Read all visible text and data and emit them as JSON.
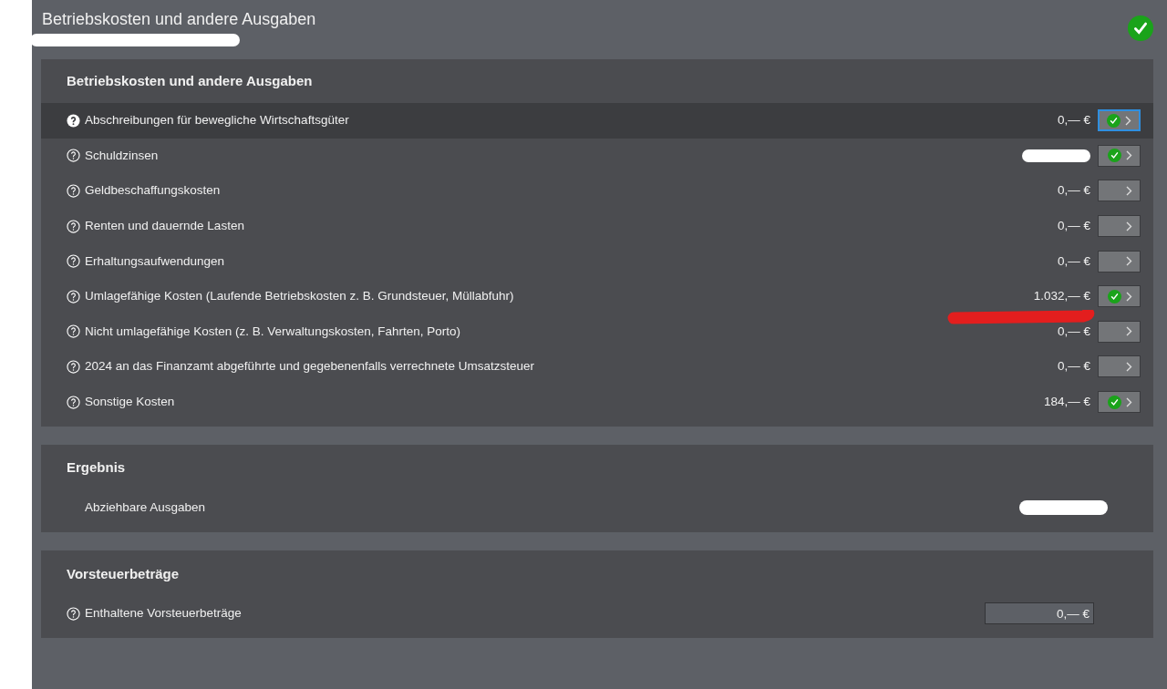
{
  "page": {
    "title": "Betriebskosten und andere Ausgaben",
    "subtitle_redacted": true,
    "complete": true
  },
  "costs": {
    "title": "Betriebskosten und andere Ausgaben",
    "rows": [
      {
        "label": "Abschreibungen für bewegliche Wirtschaftsgüter",
        "value": "0,— €",
        "done": true,
        "selected": true
      },
      {
        "label": "Schuldzinsen",
        "redacted": true,
        "done": true,
        "selected": false
      },
      {
        "label": "Geldbeschaffungskosten",
        "value": "0,— €",
        "done": false,
        "selected": false
      },
      {
        "label": "Renten und dauernde Lasten",
        "value": "0,— €",
        "done": false,
        "selected": false
      },
      {
        "label": "Erhaltungsaufwendungen",
        "value": "0,— €",
        "done": false,
        "selected": false
      },
      {
        "label": "Umlagefähige Kosten (Laufende Betriebskosten z. B. Grundsteuer, Müllabfuhr)",
        "value": "1.032,— €",
        "done": true,
        "selected": false,
        "red_mark": true
      },
      {
        "label": "Nicht umlagefähige Kosten (z. B. Verwaltungskosten, Fahrten, Porto)",
        "value": "0,— €",
        "done": false,
        "selected": false
      },
      {
        "label": "2024 an das Finanzamt abgeführte und gegebenenfalls verrechnete Umsatzsteuer",
        "value": "0,— €",
        "done": false,
        "selected": false
      },
      {
        "label": "Sonstige Kosten",
        "value": "184,— €",
        "done": true,
        "selected": false
      }
    ]
  },
  "result": {
    "title": "Ergebnis",
    "label": "Abziehbare Ausgaben",
    "redacted": true
  },
  "input_tax": {
    "title": "Vorsteuerbeträge",
    "label": "Enthaltene Vorsteuerbeträge",
    "value": "0,— €"
  }
}
